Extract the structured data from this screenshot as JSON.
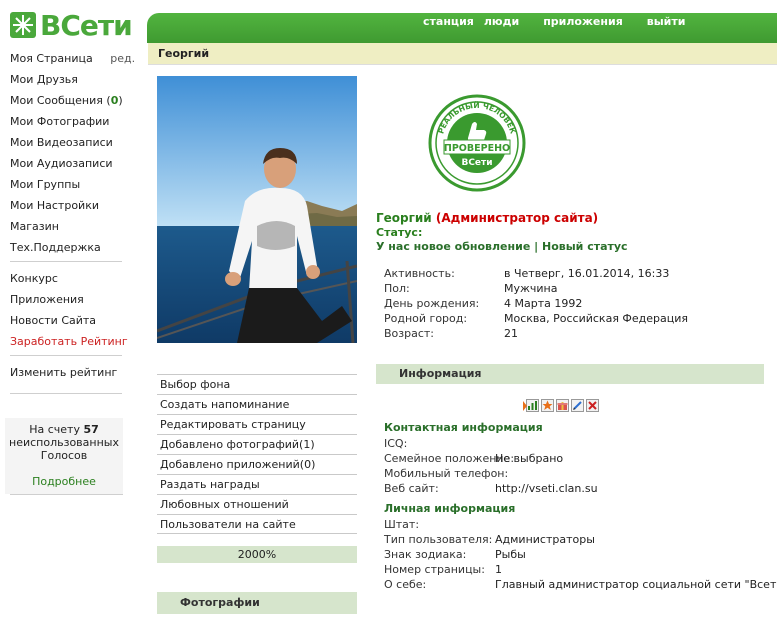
{
  "app": {
    "logo_text": "ВСети"
  },
  "topnav": [
    "станция",
    "люди",
    "приложения",
    "выйти"
  ],
  "sidebar": {
    "items": [
      {
        "label": "Моя Страница",
        "edit": "ред."
      },
      {
        "label": "Мои Друзья"
      },
      {
        "label": "Мои Сообщения",
        "count_open": " (",
        "count": "0",
        "count_close": ")"
      },
      {
        "label": "Мои Фотографии"
      },
      {
        "label": "Мои Видеозаписи"
      },
      {
        "label": "Мои Аудиозаписи"
      },
      {
        "label": "Мои Группы"
      },
      {
        "label": "Мои Настройки"
      },
      {
        "label": "Магазин"
      },
      {
        "label": "Тех.Поддержка"
      }
    ],
    "items2": [
      "Конкурс",
      "Приложения",
      "Новости Сайта",
      "Заработать Рейтинг"
    ],
    "items3": [
      "Изменить рейтинг"
    ],
    "votes": {
      "prefix": "На счету",
      "count": "57",
      "suffix1": "неиспользованных",
      "suffix2": "Голосов",
      "more": "Подробнее"
    }
  },
  "profile": {
    "page_title": "Георгий",
    "name": "Георгий",
    "role": "(Администратор сайта)",
    "status_label": "Статус:",
    "status_text": "У нас новое обновление",
    "status_sep": " | ",
    "status_link": "Новый статус",
    "badge": {
      "top": "РЕАЛЬНЫЙ ЧЕЛОВЕК",
      "main": "ПРОВЕРЕНО",
      "brand": "ВСети"
    },
    "details": [
      {
        "k": "Активность:",
        "v": "в Четверг, 16.01.2014, 16:33"
      },
      {
        "k": "Пол:",
        "v": "Мужчина"
      },
      {
        "k": "День рождения:",
        "v": "4 Марта 1992"
      },
      {
        "k": "Родной город:",
        "v": "Москва, Российская Федерация"
      },
      {
        "k": "Возраст:",
        "v": "21"
      }
    ]
  },
  "left_menu": [
    "Выбор фона",
    "Создать напоминание",
    "Редактировать страницу",
    "Добавлено фотографий(1)",
    "Добавлено приложений(0)",
    "Раздать награды",
    "Любовных отношений",
    "Пользователи на сайте"
  ],
  "progress": "2000%",
  "photos_head": "Фотографии",
  "info": {
    "head": "Информация",
    "contact_title": "Контактная информация",
    "contact": [
      {
        "k": "ICQ:",
        "v": ""
      },
      {
        "k": "Семейное положение:",
        "v": "Не выбрано"
      },
      {
        "k": "Мобильный телефон:",
        "v": ""
      },
      {
        "k": "Веб сайт:",
        "v": "http://vseti.clan.su"
      }
    ],
    "personal_title": "Личная информация",
    "personal": [
      {
        "k": "Штат:",
        "v": ""
      },
      {
        "k": "Тип пользователя:",
        "v": "Администраторы"
      },
      {
        "k": "Знак зодиака:",
        "v": "Рыбы"
      },
      {
        "k": "Номер страницы:",
        "v": "1"
      },
      {
        "k": "О себе:",
        "v": "Главный администратор социальной сети \"Всети\"."
      }
    ]
  },
  "colors": {
    "brand_green": "#4aa83b",
    "admin_red": "#cc0000",
    "panel_green": "#d6e5cc",
    "title_bar": "#efeec3"
  }
}
